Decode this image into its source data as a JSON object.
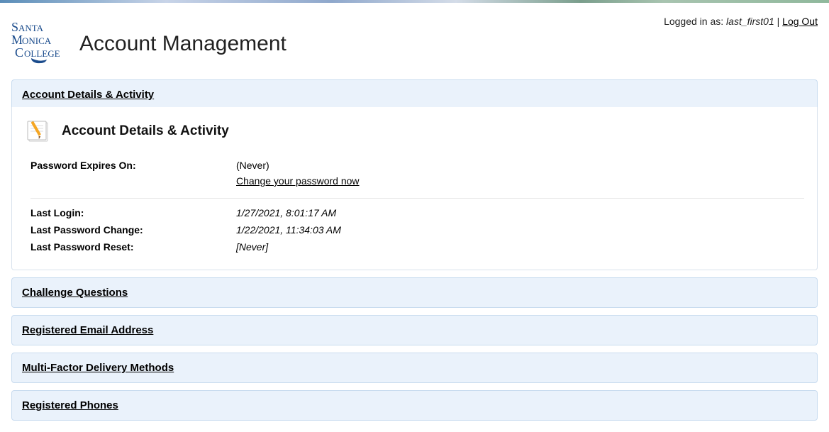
{
  "header": {
    "title": "Account Management",
    "logged_in_prefix": "Logged in as: ",
    "username": "last_first01",
    "separator": " | ",
    "logout": "Log Out"
  },
  "panels": {
    "account_details": {
      "header": "Account Details & Activity",
      "body_title": "Account Details & Activity",
      "rows": {
        "password_expires": {
          "label": "Password Expires On:",
          "value": "(Never)"
        },
        "change_password": "Change your password now",
        "last_login": {
          "label": "Last Login:",
          "value": "1/27/2021, 8:01:17 AM"
        },
        "last_pw_change": {
          "label": "Last Password Change:",
          "value": "1/22/2021, 11:34:03 AM"
        },
        "last_pw_reset": {
          "label": "Last Password Reset:",
          "value": "[Never]"
        }
      }
    },
    "challenge_questions": "Challenge Questions",
    "registered_email": "Registered Email Address",
    "mfa_methods": "Multi-Factor Delivery Methods",
    "registered_phones": "Registered Phones"
  }
}
